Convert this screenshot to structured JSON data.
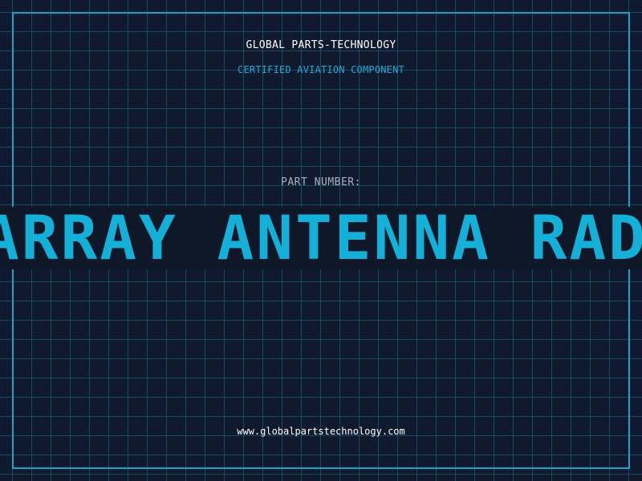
{
  "brand": {
    "title": "GLOBAL PARTS-TECHNOLOGY",
    "subtitle": "CERTIFIED AVIATION COMPONENT"
  },
  "part": {
    "label": "PART NUMBER:",
    "value": "ARRAY ANTENNA RADAR"
  },
  "footer": {
    "website": "www.globalpartstechnology.com"
  },
  "colors": {
    "background": "#101a2e",
    "grid": "#266e87",
    "accent": "#1aa3c9",
    "banner_text": "#14b0d8",
    "label_text": "#a7b2c2",
    "title_text": "#ffffff"
  }
}
